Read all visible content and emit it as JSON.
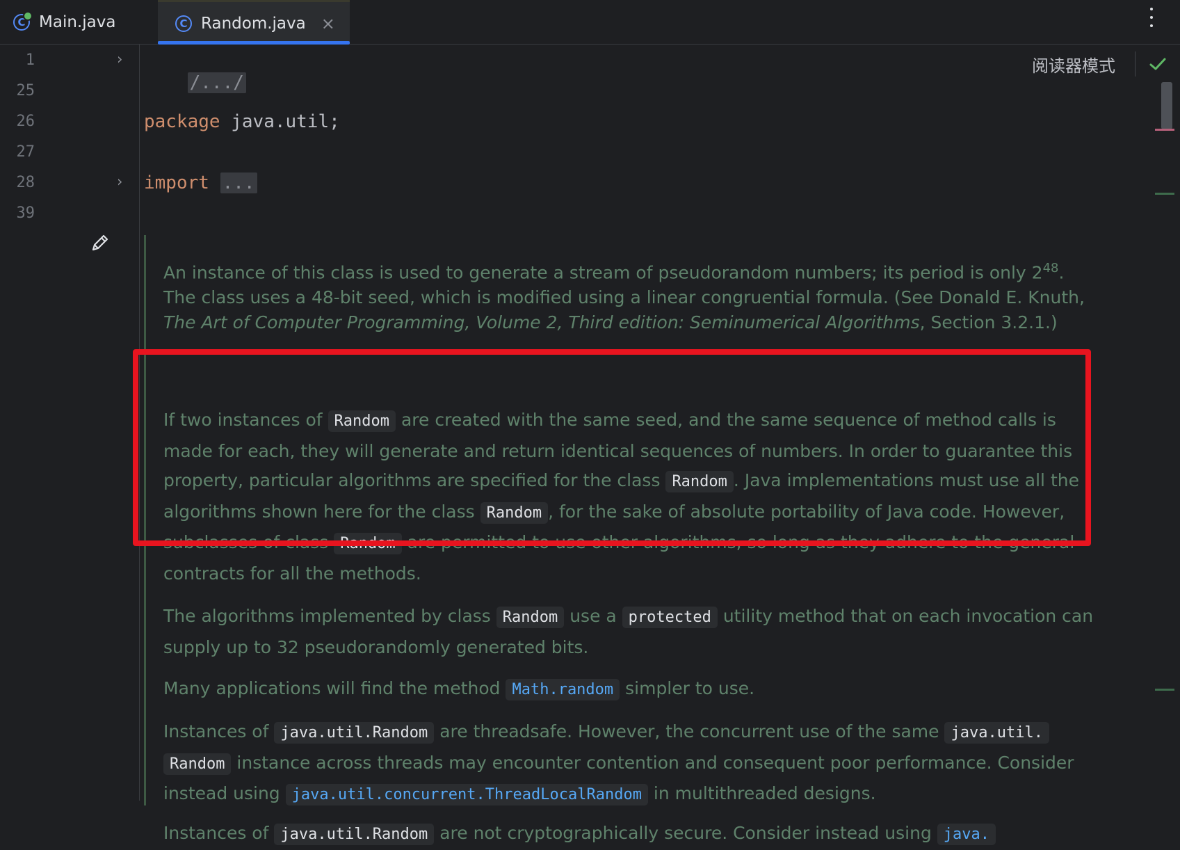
{
  "tabs": [
    {
      "label": "Main.java",
      "icon": "java-class-icon"
    },
    {
      "label": "Random.java",
      "icon": "java-class-icon",
      "active": true
    }
  ],
  "gutter": {
    "line_numbers": [
      "1",
      "25",
      "26",
      "27",
      "28",
      "39"
    ]
  },
  "code": {
    "folded_header": "/.../",
    "package_kw": "package",
    "package_name": " java.util;",
    "import_kw": "import",
    "import_folded": "..."
  },
  "reader_mode": "阅读器模式",
  "doc": {
    "p1": {
      "t1": "An instance of this class is used to generate a stream of pseudorandom numbers; its period is only 2",
      "sup": "48",
      "t2": ". The class uses a 48-bit seed, which is modified using a linear congruential formula. (See Donald E. Knuth, ",
      "italic": "The Art of Computer Programming, Volume 2, Third edition: Seminumerical Algorithms",
      "t3": ", Section 3.2.1.)"
    },
    "p2": {
      "t1": "If two instances of ",
      "c1": "Random",
      "t2": " are created with the same seed, and the same sequence of method calls is made for each, they will generate and return identical sequences of numbers. In order to guarantee this property, particular algorithms are specified for the class ",
      "c2": "Random",
      "t3": ". Java implementations must use all the algorithms shown here for the class ",
      "c3": "Random",
      "t4": ", for the sake of absolute portability of Java code. However, subclasses of class ",
      "c4": "Random",
      "t5": " are permitted to use other algorithms, so long as they adhere to the general contracts for all the methods."
    },
    "p3": {
      "t1": "The algorithms implemented by class ",
      "c1": "Random",
      "t2": " use a ",
      "c2": "protected",
      "t3": " utility method that on each invocation can supply up to 32 pseudorandomly generated bits."
    },
    "p4": {
      "t1": "Many applications will find the method ",
      "l1": "Math.random",
      "t2": " simpler to use."
    },
    "p5": {
      "t1": "Instances of ",
      "c1": "java.util.Random",
      "t2": " are threadsafe. However, the concurrent use of the same ",
      "c2": "java.util.",
      "c3": "Random",
      "t3": " instance across threads may encounter contention and consequent poor performance. Consider instead using ",
      "l1": "java.util.concurrent.ThreadLocalRandom",
      "t4": " in multithreaded designs."
    },
    "p6": {
      "t1": "Instances of ",
      "c1": "java.util.Random",
      "t2": " are not cryptographically secure. Consider instead using ",
      "l1": "java."
    }
  },
  "colors": {
    "background": "#1e1f22",
    "doc_text": "#5f826b",
    "keyword": "#cf8e6d",
    "link": "#56a8f5",
    "highlight_box": "#e8141f",
    "active_tab_underline": "#3574f0"
  }
}
